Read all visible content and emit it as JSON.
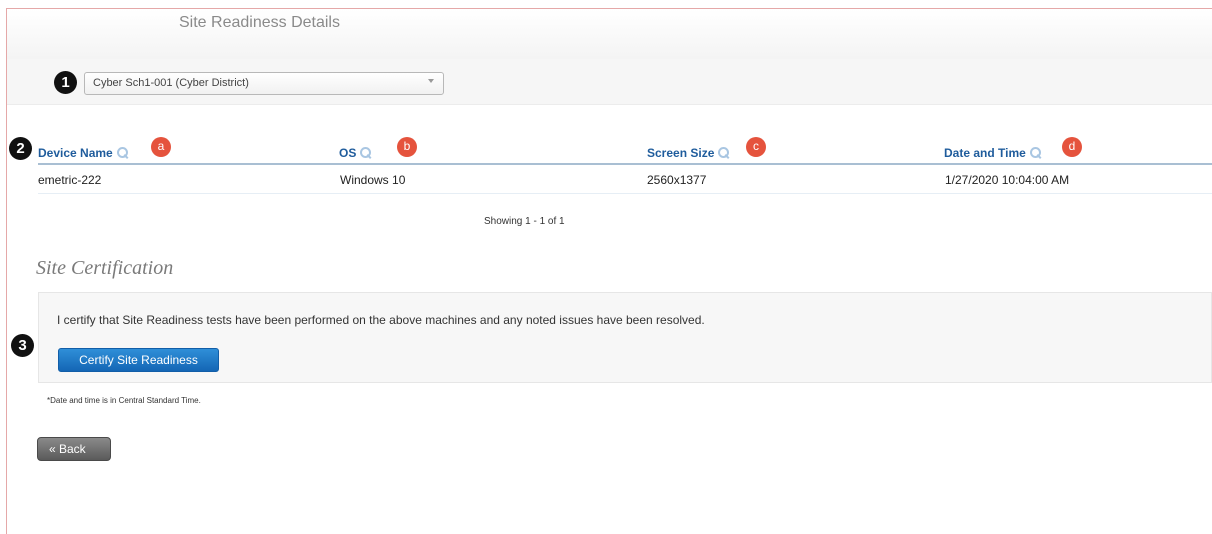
{
  "header": {
    "title": "Site Readiness Details"
  },
  "school_select": {
    "selected": "Cyber Sch1-001 (Cyber District)"
  },
  "callouts": {
    "one": "1",
    "two": "2",
    "three": "3"
  },
  "table": {
    "columns": [
      {
        "label": "Device Name",
        "letter": "a"
      },
      {
        "label": "OS",
        "letter": "b"
      },
      {
        "label": "Screen Size",
        "letter": "c"
      },
      {
        "label": "Date and Time",
        "letter": "d"
      }
    ],
    "rows": [
      {
        "device_name": "emetric-222",
        "os": "Windows 10",
        "screen_size": "2560x1377",
        "date_time": "1/27/2020 10:04:00 AM"
      }
    ],
    "pager_text": "Showing 1 - 1 of 1"
  },
  "certification": {
    "title": "Site Certification",
    "statement": "I certify that Site Readiness tests have been performed on the above machines and any noted issues have been resolved.",
    "button_label": "Certify Site Readiness"
  },
  "footnote": "*Date and time is in Central Standard Time.",
  "back_label": "« Back",
  "colors": {
    "header_link": "#1f5c9c",
    "primary_button": "#1a72c4",
    "callout_letter": "#e5533d"
  }
}
